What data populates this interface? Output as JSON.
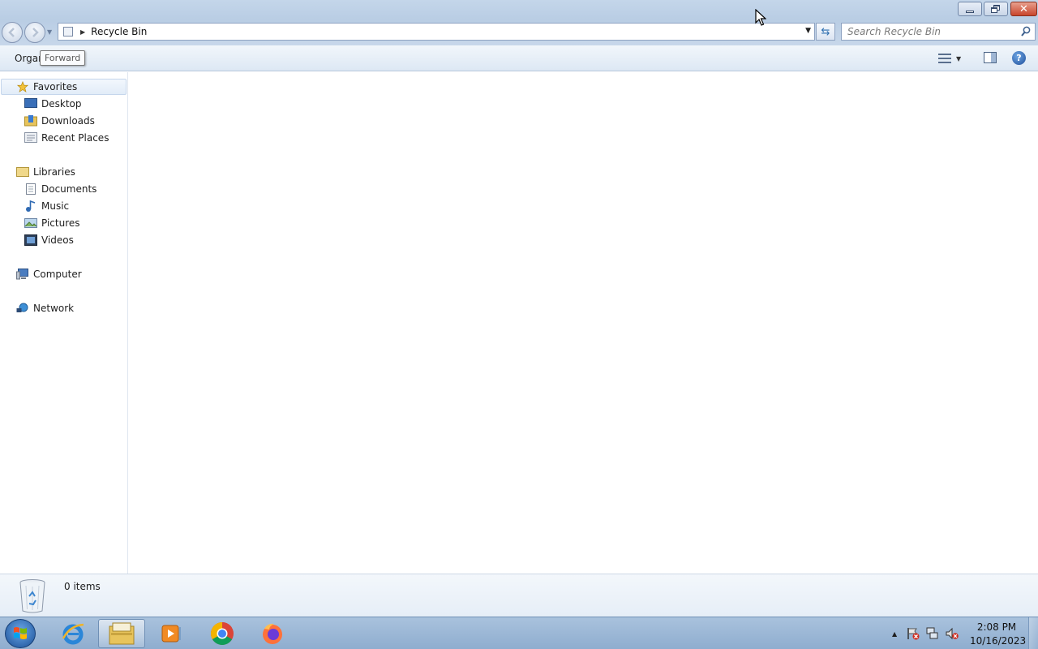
{
  "window": {
    "minimize_label": "—",
    "close_label": "✕"
  },
  "address": {
    "location": "Recycle Bin",
    "search_placeholder": "Search Recycle Bin"
  },
  "toolbar": {
    "organize_label": "Organ",
    "tooltip_text": "Forward"
  },
  "nav": {
    "favorites": {
      "label": "Favorites",
      "items": [
        "Desktop",
        "Downloads",
        "Recent Places"
      ]
    },
    "libraries": {
      "label": "Libraries",
      "items": [
        "Documents",
        "Music",
        "Pictures",
        "Videos"
      ]
    },
    "computer": "Computer",
    "network": "Network"
  },
  "details": {
    "count_text": "0 items"
  },
  "taskbar": {
    "apps": [
      "internet-explorer",
      "windows-explorer",
      "media-player",
      "chrome",
      "firefox"
    ],
    "time": "2:08 PM",
    "date": "10/16/2023"
  },
  "colors": {
    "titlebar": "#c4d6ea",
    "accent": "#2e6fb0",
    "close": "#c8452c",
    "taskbar": "#9ab6d6"
  }
}
